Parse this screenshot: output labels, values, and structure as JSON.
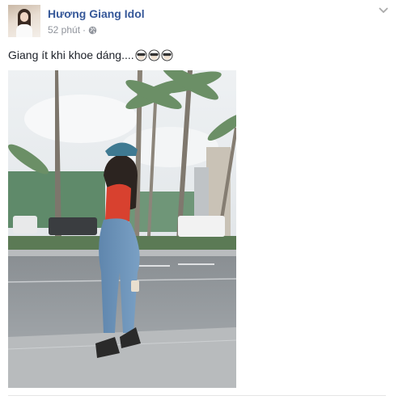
{
  "post": {
    "author_name": "Hương Giang Idol",
    "time_label": "52 phút",
    "separator": "·",
    "caption": "Giang ít khi khoe dáng....",
    "emoji_count": 3
  },
  "icons": {
    "privacy": "globe-icon",
    "options": "chevron-down-icon",
    "emoji": "see-no-evil-monkey-emoji"
  },
  "colors": {
    "author_link": "#365899",
    "meta_text": "#90949c",
    "body_text": "#1d2129"
  }
}
